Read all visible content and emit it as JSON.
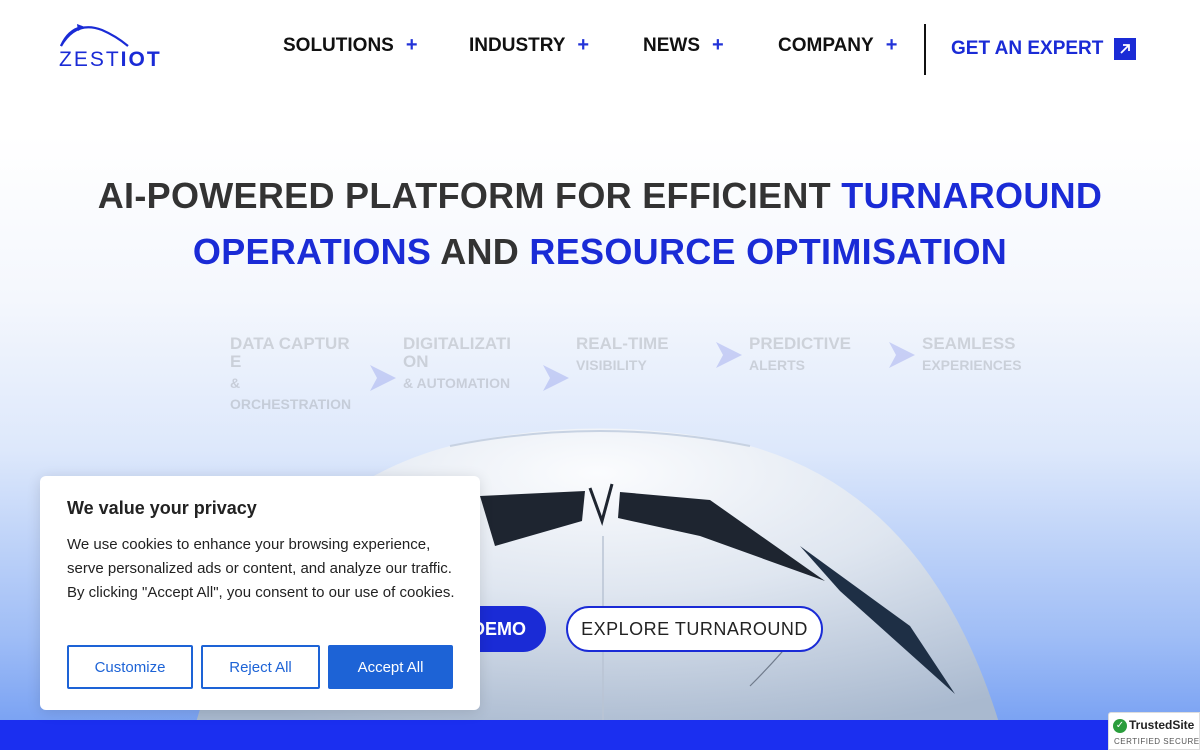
{
  "brand": {
    "logo_thin": "ZEST",
    "logo_bold": "IOT",
    "accent": "#1a2bd6"
  },
  "nav": {
    "items": [
      {
        "label": "SOLUTIONS",
        "icon": "plus-icon"
      },
      {
        "label": "INDUSTRY",
        "icon": "plus-icon"
      },
      {
        "label": "NEWS",
        "icon": "plus-icon"
      },
      {
        "label": "COMPANY",
        "icon": "plus-icon"
      }
    ],
    "expand_glyph": "+",
    "cta": {
      "label": "GET AN EXPERT",
      "icon": "arrow-up-right-icon"
    }
  },
  "hero": {
    "title_part1": "AI-POWERED PLATFORM FOR EFFICIENT ",
    "title_hl1": "TURNAROUND OPERATIONS",
    "title_part2": " AND ",
    "title_hl2": "RESOURCE OPTIMISATION",
    "steps": [
      {
        "title": "DATA CAPTURE",
        "sub": "& ORCHESTRATION"
      },
      {
        "title": "DIGITALIZATION",
        "sub": "& AUTOMATION"
      },
      {
        "title": "REAL-TIME",
        "sub": "VISIBILITY"
      },
      {
        "title": "PREDICTIVE",
        "sub": "ALERTS"
      },
      {
        "title": "SEAMLESS",
        "sub": "EXPERIENCES"
      }
    ],
    "demo_button": "DEMO",
    "explore_button": "EXPLORE TURNAROUND"
  },
  "cookie": {
    "title": "We value your privacy",
    "body": "We use cookies to enhance your browsing experience, serve personalized ads or content, and analyze our traffic. By clicking \"Accept All\", you consent to our use of cookies.",
    "customize": "Customize",
    "reject": "Reject All",
    "accept": "Accept All"
  },
  "trusted_site": {
    "name": "TrustedSite",
    "sub": "CERTIFIED SECURE",
    "check": "✓"
  }
}
